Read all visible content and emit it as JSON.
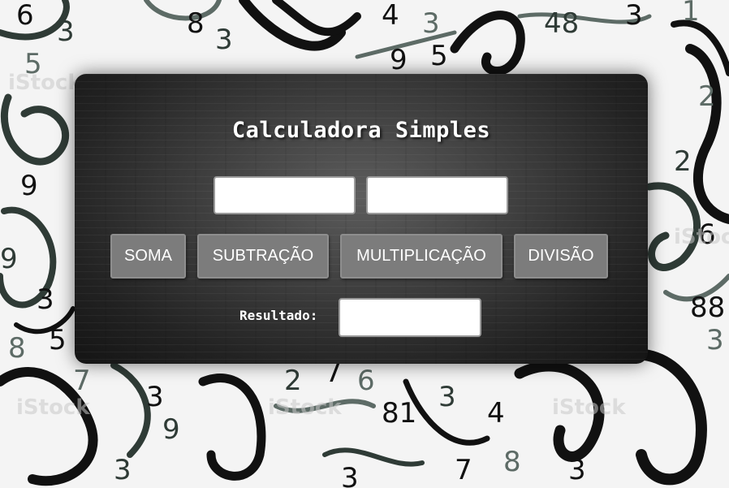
{
  "background": {
    "style": "handwritten-numbers",
    "watermark": "iStock by Getty Images",
    "ink_colors": [
      "#111111",
      "#2f3b36",
      "#5d6b66"
    ]
  },
  "calculator": {
    "title": "Calculadora Simples",
    "input1": {
      "value": "",
      "placeholder": ""
    },
    "input2": {
      "value": "",
      "placeholder": ""
    },
    "buttons": {
      "soma": "SOMA",
      "subtracao": "SUBTRAÇÃO",
      "multiplicacao": "MULTIPLICAÇÃO",
      "divisao": "DIVISÃO"
    },
    "result_label": "Resultado:",
    "result_value": ""
  },
  "colors": {
    "panel": "#3a3a3a",
    "button": "#7c7c7c",
    "text": "#ffffff"
  }
}
